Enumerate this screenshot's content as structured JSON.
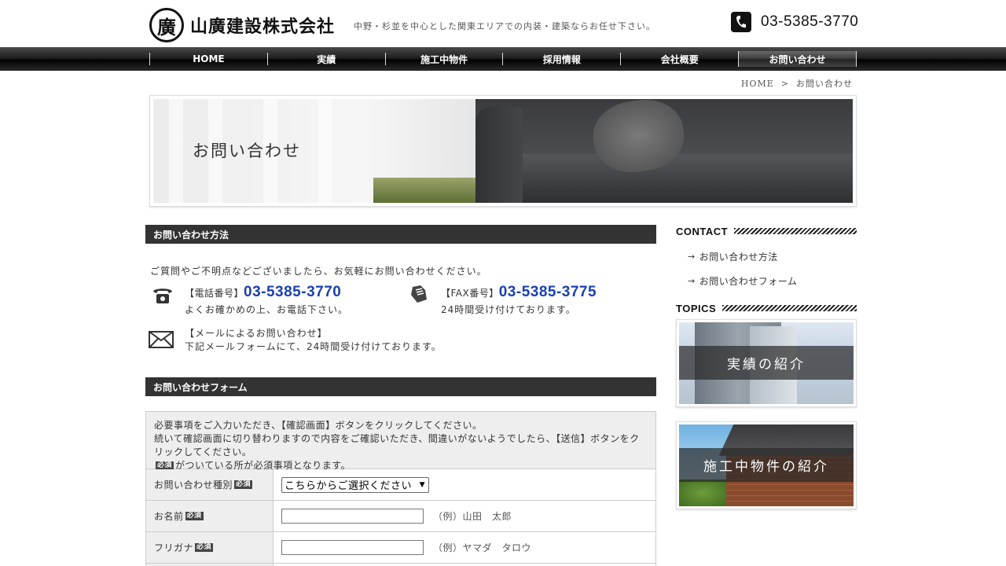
{
  "header": {
    "logo_mark": "廣",
    "logo_text": "山廣建設株式会社",
    "tagline": "中野・杉並を中心とした関東エリアでの内装・建築ならお任せ下さい。",
    "phone": "03-5385-3770"
  },
  "nav": {
    "items": [
      {
        "label": "HOME"
      },
      {
        "label": "実績"
      },
      {
        "label": "施工中物件"
      },
      {
        "label": "採用情報"
      },
      {
        "label": "会社概要"
      },
      {
        "label": "お問い合わせ"
      }
    ],
    "active_index": 5
  },
  "breadcrumb": {
    "home": "HOME",
    "sep": ">",
    "current": "お問い合わせ"
  },
  "banner": {
    "title": "お問い合わせ"
  },
  "method": {
    "heading": "お問い合わせ方法",
    "intro": "ご質問やご不明点などございましたら、お気軽にお問い合わせください。",
    "tel_label": "【電話番号】",
    "tel_number": "03-5385-3770",
    "tel_note": "よくお確かめの上、お電話下さい。",
    "fax_label": "【FAX番号】",
    "fax_number": "03-5385-3775",
    "fax_note": "24時間受け付けております。",
    "mail_label": "【メールによるお問い合わせ】",
    "mail_note": "下記メールフォームにて、24時間受け付けております。"
  },
  "form": {
    "heading": "お問い合わせフォーム",
    "note_line1": "必要事項をご入力いただき、【確認画面】ボタンをクリックしてください。",
    "note_line2": "続いて確認画面に切り替わりますので内容をご確認いただき、間違いがないようでしたら、【送信】ボタンをクリックしてください。",
    "note_line3": "がついている所が必須事項となります。",
    "required_badge": "必須",
    "type_label": "お問い合わせ種別",
    "type_select": "こちらからご選択ください",
    "name_label": "お名前",
    "name_example": "（例）山田　太郎",
    "kana_label": "フリガナ",
    "kana_example": "（例）ヤマダ　タロウ"
  },
  "sidebar": {
    "contact_heading": "CONTACT",
    "contact_links": [
      "お問い合わせ方法",
      "お問い合わせフォーム"
    ],
    "topics_heading": "TOPICS",
    "topic1": "実績の紹介",
    "topic2": "施工中物件の紹介"
  }
}
